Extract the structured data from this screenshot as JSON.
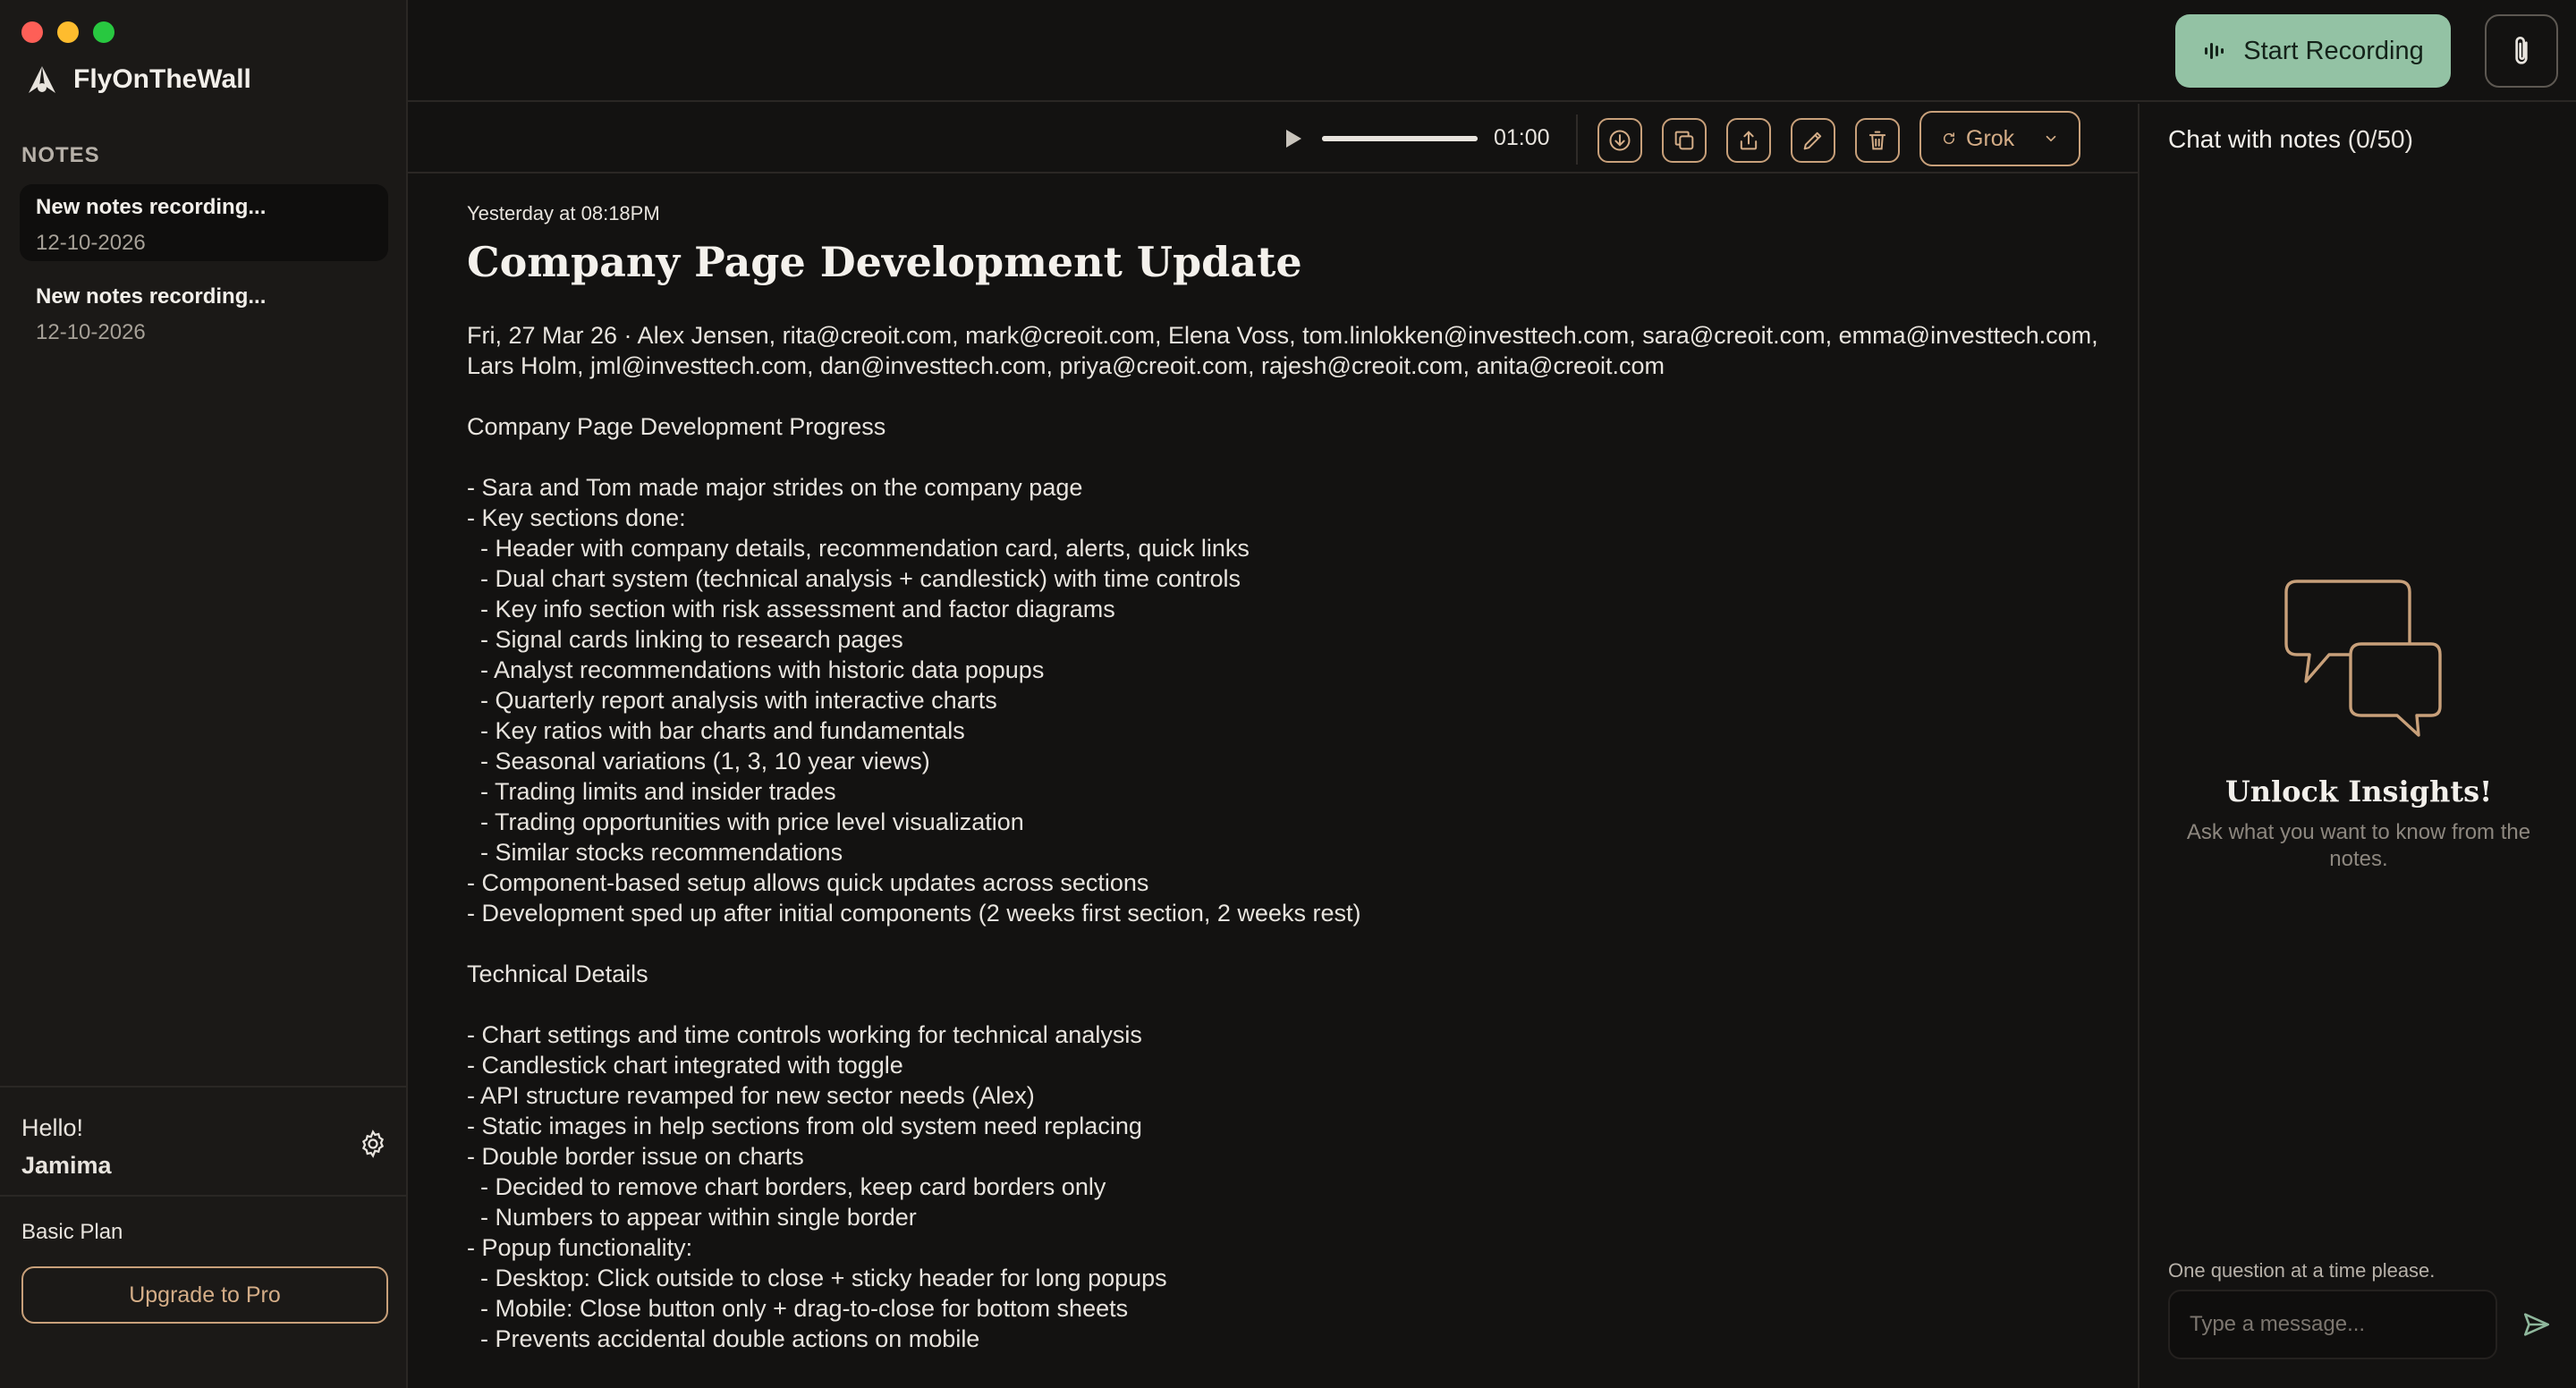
{
  "sidebar": {
    "brand": "FlyOnTheWall",
    "section_label": "NOTES",
    "notes": [
      {
        "title": "New notes recording...",
        "date": "12-10-2026"
      },
      {
        "title": "New notes recording...",
        "date": "12-10-2026"
      }
    ],
    "greeting": "Hello!",
    "user_name": "Jamima",
    "plan": "Basic Plan",
    "upgrade_label": "Upgrade to Pro"
  },
  "topbar": {
    "start_recording_label": "Start Recording"
  },
  "player": {
    "time": "01:00",
    "progress": 1.0,
    "model": "Grok"
  },
  "note": {
    "timestamp": "Yesterday at 08:18PM",
    "title": "Company Page Development Update",
    "meta": "Fri, 27 Mar 26 · Alex Jensen, rita@creoit.com, mark@creoit.com, Elena Voss, tom.linlokken@investtech.com, sara@creoit.com, emma@investtech.com, Lars Holm, jml@investtech.com, dan@investtech.com, priya@creoit.com, rajesh@creoit.com, anita@creoit.com",
    "lines": [
      "Company Page Development Progress",
      "",
      "- Sara and Tom made major strides on the company page",
      "- Key sections done:",
      "  - Header with company details, recommendation card, alerts, quick links",
      "  - Dual chart system (technical analysis + candlestick) with time controls",
      "  - Key info section with risk assessment and factor diagrams",
      "  - Signal cards linking to research pages",
      "  - Analyst recommendations with historic data popups",
      "  - Quarterly report analysis with interactive charts",
      "  - Key ratios with bar charts and fundamentals",
      "  - Seasonal variations (1, 3, 10 year views)",
      "  - Trading limits and insider trades",
      "  - Trading opportunities with price level visualization",
      "  - Similar stocks recommendations",
      "- Component-based setup allows quick updates across sections",
      "- Development sped up after initial components (2 weeks first section, 2 weeks rest)",
      "",
      "Technical Details",
      "",
      "- Chart settings and time controls working for technical analysis",
      "- Candlestick chart integrated with toggle",
      "- API structure revamped for new sector needs (Alex)",
      "- Static images in help sections from old system need replacing",
      "- Double border issue on charts",
      "  - Decided to remove chart borders, keep card borders only",
      "  - Numbers to appear within single border",
      "- Popup functionality:",
      "  - Desktop: Click outside to close + sticky header for long popups",
      "  - Mobile: Close button only + drag-to-close for bottom sheets",
      "  - Prevents accidental double actions on mobile"
    ]
  },
  "chat": {
    "title": "Chat with notes",
    "count": "(0/50)",
    "empty_title": "Unlock Insights!",
    "empty_subtitle": "Ask what you want to know from the notes.",
    "hint": "One question at a time please.",
    "input_placeholder": "Type a message..."
  },
  "colors": {
    "accent": "#c8a07a",
    "record_green": "#93c2a4",
    "background": "#131211",
    "sidebar": "#1b1917"
  },
  "icons": [
    "fly-logo-icon",
    "gear-icon",
    "waveform-icon",
    "paperclip-icon",
    "play-icon",
    "download-icon",
    "copy-icon",
    "share-icon",
    "edit-icon",
    "trash-icon",
    "refresh-icon",
    "chevron-down-icon",
    "chat-bubbles-icon",
    "send-icon"
  ]
}
